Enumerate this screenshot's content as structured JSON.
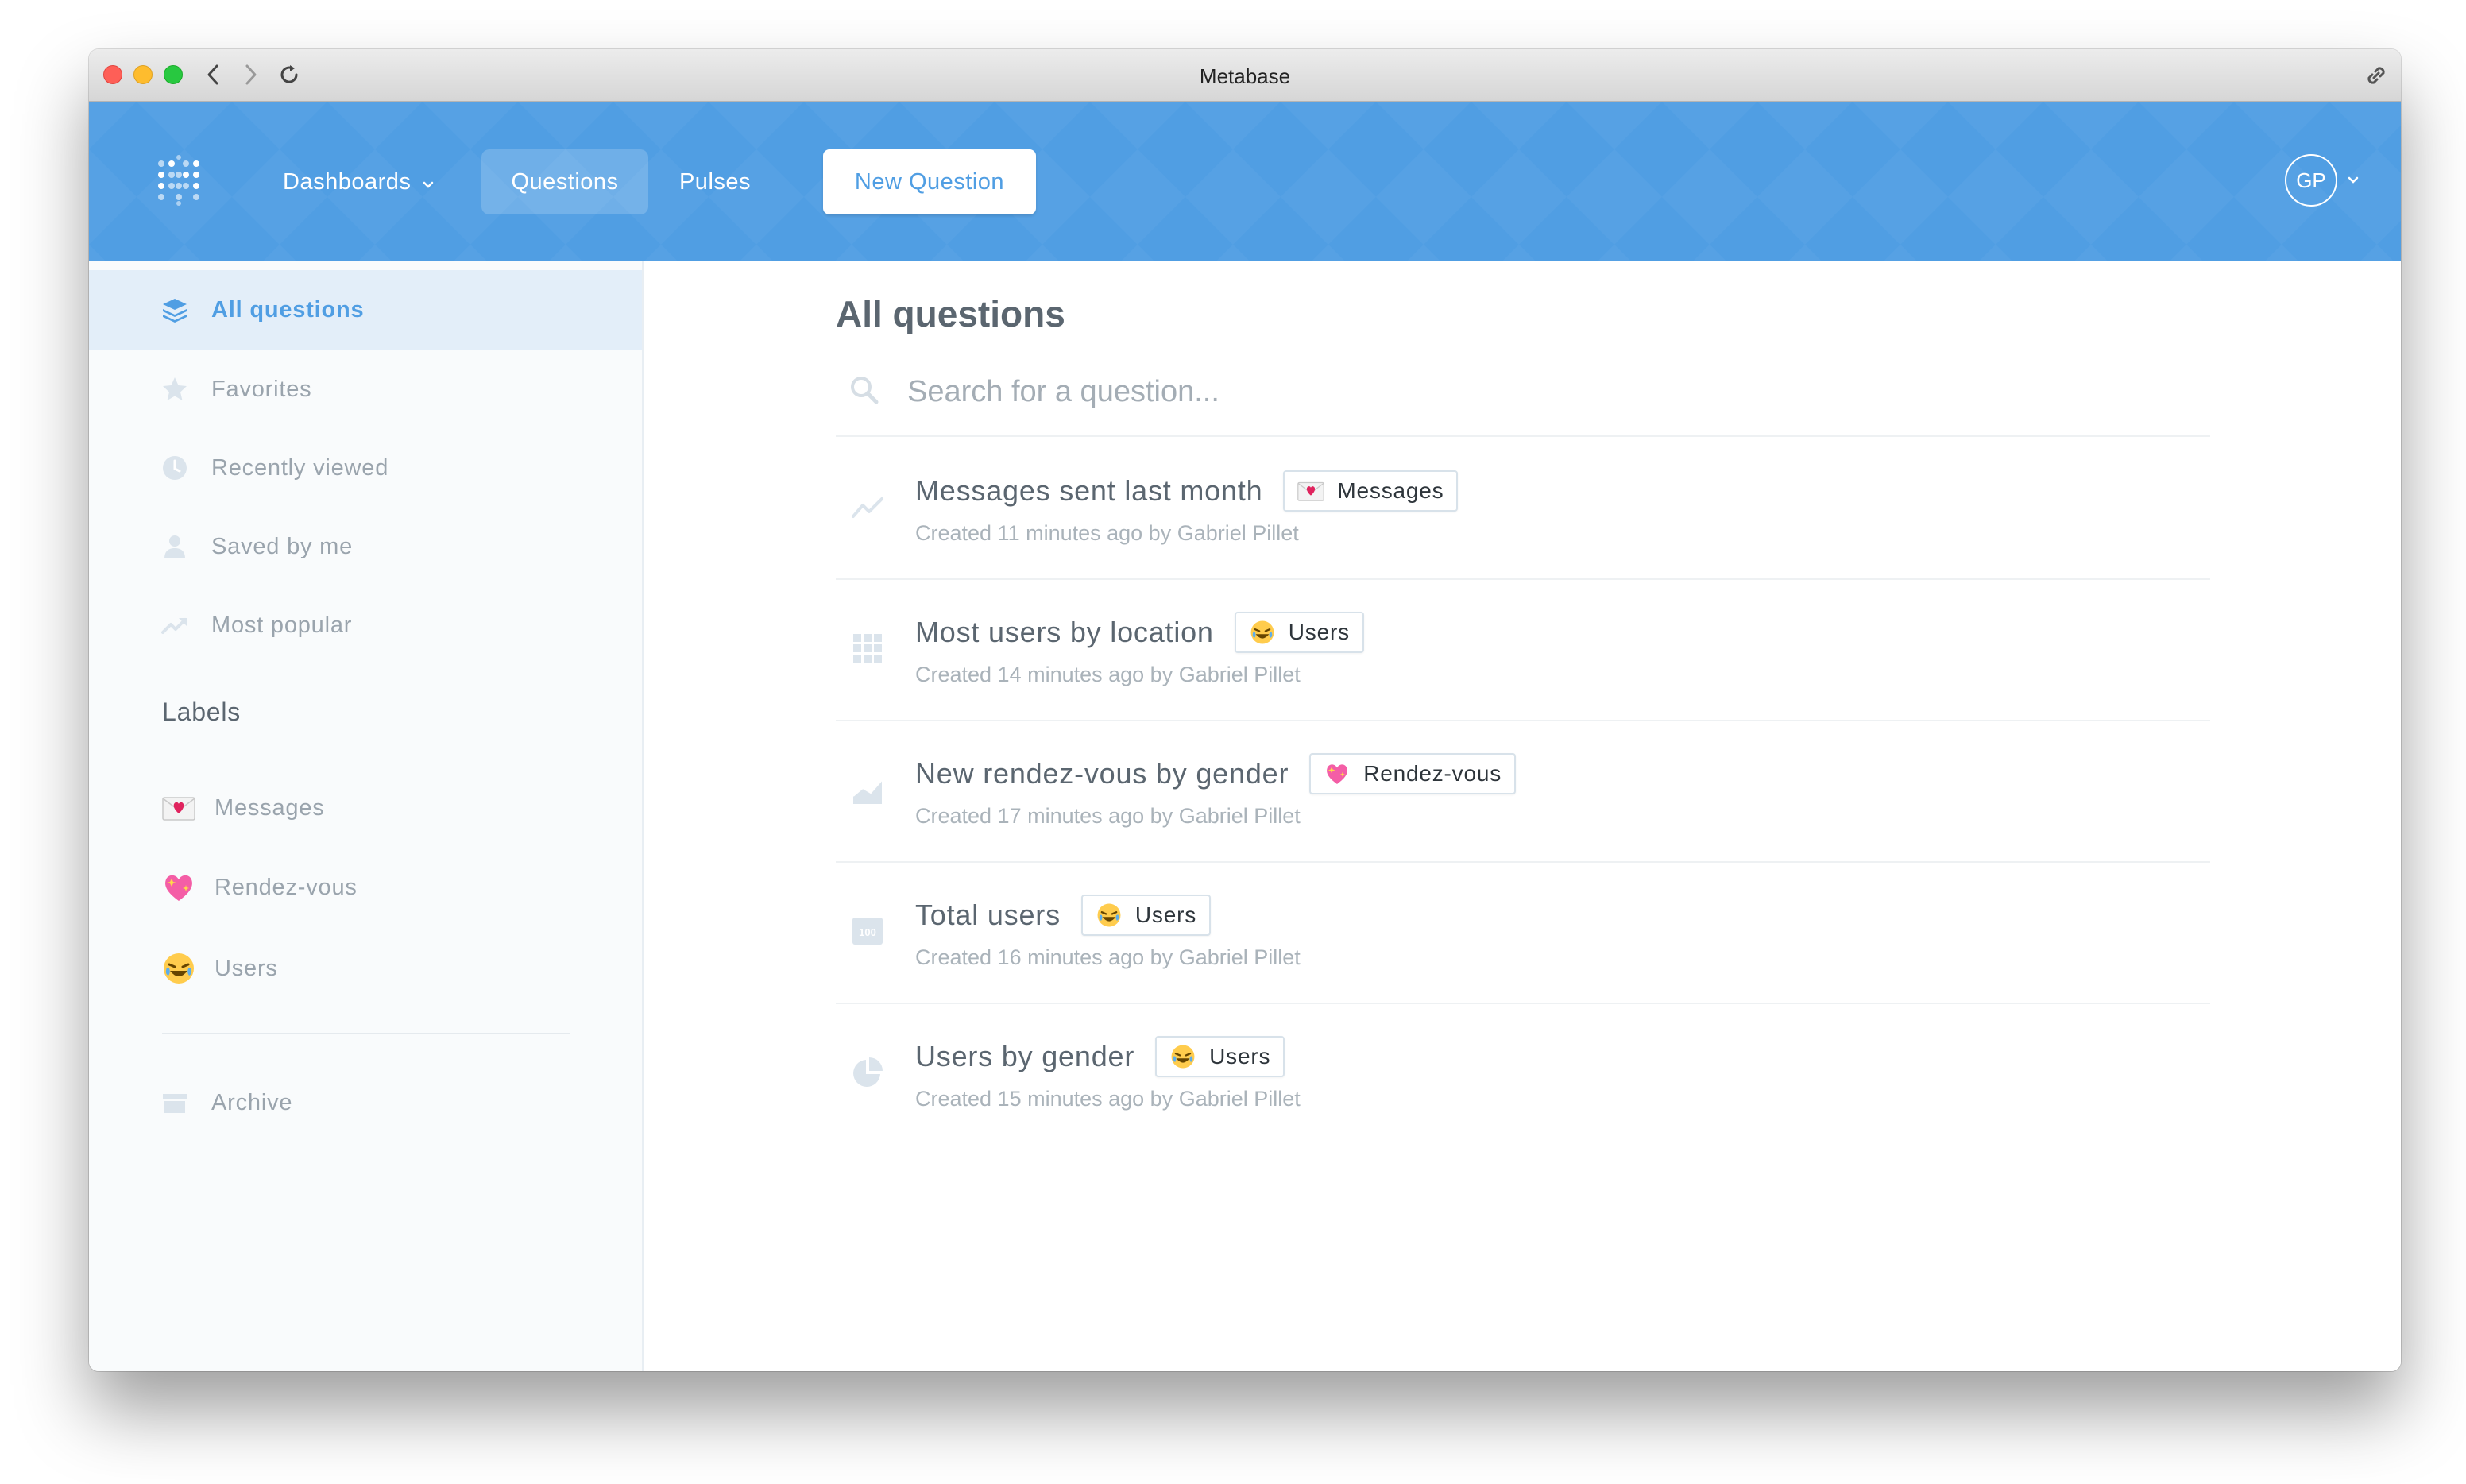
{
  "window": {
    "title": "Metabase"
  },
  "header": {
    "nav": {
      "dashboards": "Dashboards",
      "questions": "Questions",
      "pulses": "Pulses"
    },
    "new_question": "New Question",
    "avatar_initials": "GP",
    "accent_color": "#509ee3"
  },
  "sidebar": {
    "items": [
      {
        "label": "All questions",
        "icon": "stack-icon",
        "active": true
      },
      {
        "label": "Favorites",
        "icon": "star-icon"
      },
      {
        "label": "Recently viewed",
        "icon": "clock-icon"
      },
      {
        "label": "Saved by me",
        "icon": "person-icon"
      },
      {
        "label": "Most popular",
        "icon": "trend-icon"
      }
    ],
    "labels_heading": "Labels",
    "labels": [
      {
        "label": "Messages",
        "emoji": "love-letter-emoji"
      },
      {
        "label": "Rendez-vous",
        "emoji": "heart-emoji"
      },
      {
        "label": "Users",
        "emoji": "laughing-emoji"
      }
    ],
    "archive": "Archive"
  },
  "main": {
    "title": "All questions",
    "search_placeholder": "Search for a question...",
    "questions": [
      {
        "title": "Messages sent last month",
        "label": "Messages",
        "label_emoji": "love-letter-emoji",
        "meta": "Created 11 minutes ago by Gabriel Pillet",
        "type_icon": "line-chart-icon"
      },
      {
        "title": "Most users by location",
        "label": "Users",
        "label_emoji": "laughing-emoji",
        "meta": "Created 14 minutes ago by Gabriel Pillet",
        "type_icon": "table-icon"
      },
      {
        "title": "New rendez-vous by gender",
        "label": "Rendez-vous",
        "label_emoji": "heart-emoji",
        "meta": "Created 17 minutes ago by Gabriel Pillet",
        "type_icon": "area-chart-icon"
      },
      {
        "title": "Total users",
        "label": "Users",
        "label_emoji": "laughing-emoji",
        "meta": "Created 16 minutes ago by Gabriel Pillet",
        "type_icon": "scalar-icon",
        "type_icon_text": "100"
      },
      {
        "title": "Users by gender",
        "label": "Users",
        "label_emoji": "laughing-emoji",
        "meta": "Created 15 minutes ago by Gabriel Pillet",
        "type_icon": "pie-chart-icon"
      }
    ]
  }
}
